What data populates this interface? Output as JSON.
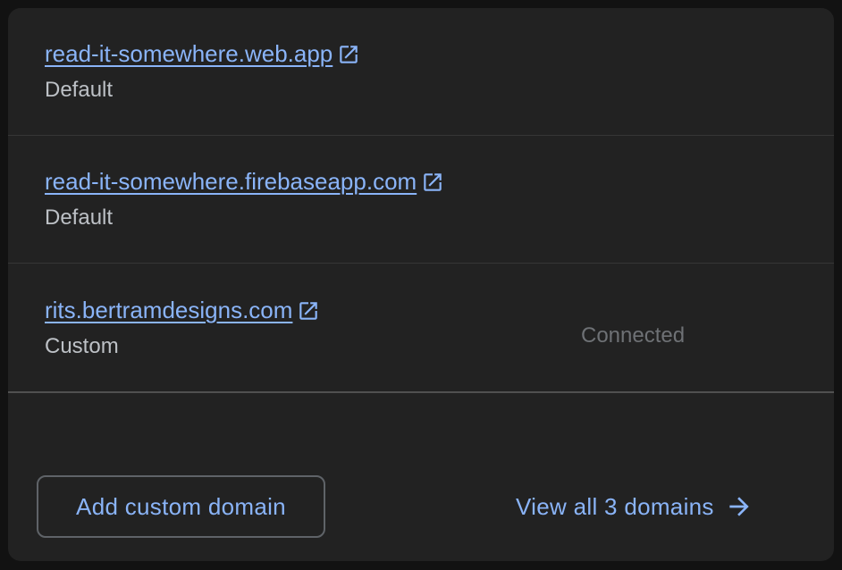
{
  "domains": [
    {
      "name": "read-it-somewhere.web.app",
      "type": "Default",
      "status": ""
    },
    {
      "name": "read-it-somewhere.firebaseapp.com",
      "type": "Default",
      "status": ""
    },
    {
      "name": "rits.bertramdesigns.com",
      "type": "Custom",
      "status": "Connected"
    }
  ],
  "actions": {
    "add_label": "Add custom domain",
    "view_all_label": "View all 3 domains"
  },
  "icons": {
    "external_link": "open-in-new-icon",
    "arrow": "arrow-right-icon"
  },
  "colors": {
    "card": "#222222",
    "link": "#8ab4f8",
    "label": "#bdc1c6",
    "status": "#6e7175",
    "divider": "#363636",
    "button_border": "#5f6368"
  }
}
